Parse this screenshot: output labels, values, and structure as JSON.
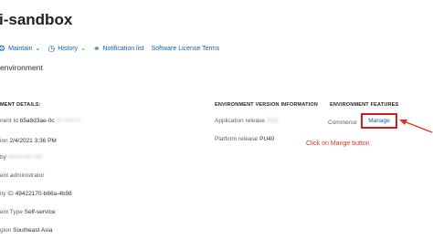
{
  "header": {
    "title": "i-sandbox"
  },
  "toolbar": {
    "maintain_label": "Maintain",
    "history_label": "History",
    "notifications_label": "Notification list",
    "license_label": "Software License Terms"
  },
  "page": {
    "subtitle": "environment"
  },
  "details": {
    "heading": "MENT DETAILS:",
    "rows": [
      {
        "label": "nent Id",
        "value": "b5a8d3ae-0c",
        "blurred": "••• ••••• ••"
      },
      {
        "label": "ion",
        "value": "2/4/2021 3:36 PM",
        "blurred": ""
      },
      {
        "label": "by",
        "value": "",
        "blurred": "••••••• •••• ••••"
      },
      {
        "label": "ent administrator",
        "value": "",
        "blurred": ""
      },
      {
        "label": "ity ID",
        "value": "49422170-b66a-4b98",
        "blurred": ""
      },
      {
        "label": "ent Type",
        "value": "Self-service",
        "blurred": ""
      },
      {
        "label": "gion",
        "value": "Southeast Asia",
        "blurred": ""
      }
    ]
  },
  "version_info": {
    "heading": "ENVIRONMENT VERSION INFORMATION",
    "app_release_label": "Application release",
    "app_release_value": "10.0",
    "platform_release_label": "Platform release",
    "platform_release_value": "PU40"
  },
  "features": {
    "heading": "ENVIRONMENT FEATURES",
    "feature_name": "Commerce",
    "manage_label": "Manage"
  },
  "annotation": {
    "text": "Click on Mange button",
    "color": "#e0331d"
  }
}
